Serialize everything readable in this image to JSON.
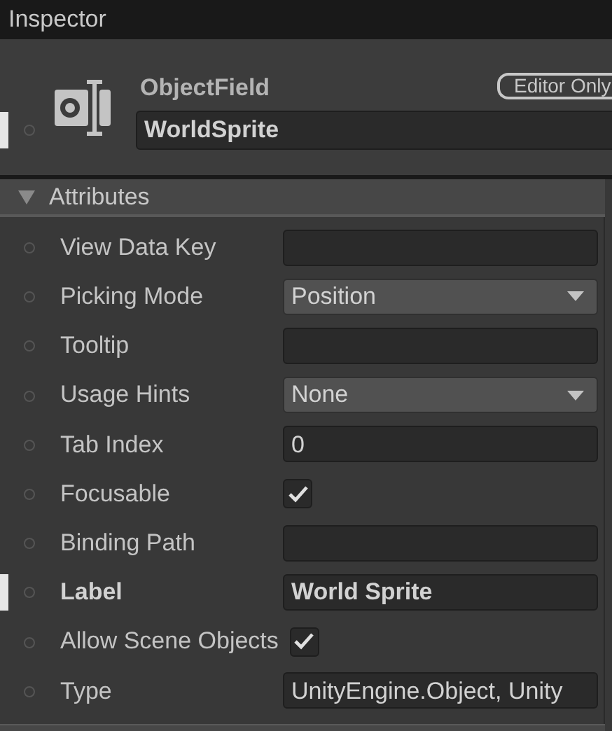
{
  "window": {
    "title": "Inspector"
  },
  "element": {
    "type_label": "ObjectField",
    "badge": "Editor Only",
    "name": "WorldSprite",
    "overridden": true
  },
  "sections": [
    {
      "title": "Attributes",
      "expanded": true,
      "rows": [
        {
          "kind": "text",
          "label": "View Data Key",
          "value": "",
          "overridden": false
        },
        {
          "kind": "dropdown",
          "label": "Picking Mode",
          "value": "Position",
          "overridden": false
        },
        {
          "kind": "text",
          "label": "Tooltip",
          "value": "",
          "overridden": false
        },
        {
          "kind": "dropdown",
          "label": "Usage Hints",
          "value": "None",
          "overridden": false
        },
        {
          "kind": "text",
          "label": "Tab Index",
          "value": "0",
          "overridden": false
        },
        {
          "kind": "checkbox",
          "label": "Focusable",
          "checked": true,
          "overridden": false
        },
        {
          "kind": "text",
          "label": "Binding Path",
          "value": "",
          "overridden": false
        },
        {
          "kind": "text",
          "label": "Label",
          "value": "World Sprite",
          "overridden": true
        },
        {
          "kind": "checkbox",
          "label": "Allow Scene Objects",
          "checked": true,
          "overridden": false
        },
        {
          "kind": "text",
          "label": "Type",
          "value": "UnityEngine.Object, Unity",
          "overridden": false
        }
      ]
    }
  ]
}
